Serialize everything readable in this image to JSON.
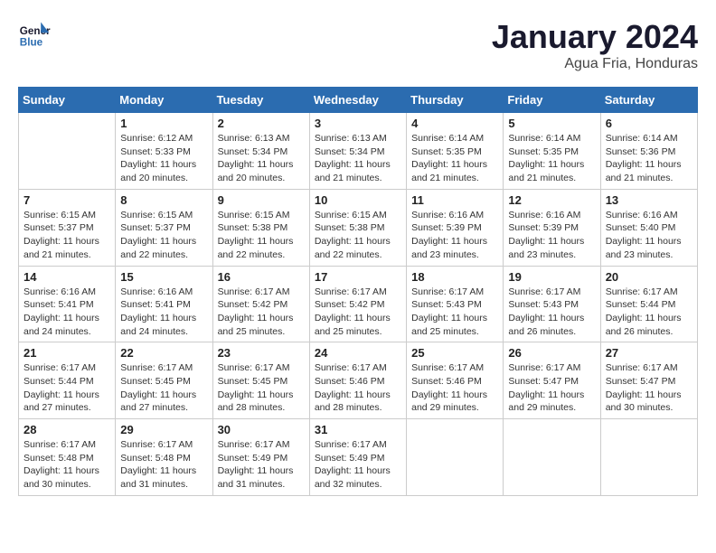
{
  "header": {
    "logo_line1": "General",
    "logo_line2": "Blue",
    "month": "January 2024",
    "location": "Agua Fria, Honduras"
  },
  "weekdays": [
    "Sunday",
    "Monday",
    "Tuesday",
    "Wednesday",
    "Thursday",
    "Friday",
    "Saturday"
  ],
  "weeks": [
    [
      {
        "day": "",
        "sunrise": "",
        "sunset": "",
        "daylight": ""
      },
      {
        "day": "1",
        "sunrise": "6:12 AM",
        "sunset": "5:33 PM",
        "daylight": "11 hours and 20 minutes."
      },
      {
        "day": "2",
        "sunrise": "6:13 AM",
        "sunset": "5:34 PM",
        "daylight": "11 hours and 20 minutes."
      },
      {
        "day": "3",
        "sunrise": "6:13 AM",
        "sunset": "5:34 PM",
        "daylight": "11 hours and 21 minutes."
      },
      {
        "day": "4",
        "sunrise": "6:14 AM",
        "sunset": "5:35 PM",
        "daylight": "11 hours and 21 minutes."
      },
      {
        "day": "5",
        "sunrise": "6:14 AM",
        "sunset": "5:35 PM",
        "daylight": "11 hours and 21 minutes."
      },
      {
        "day": "6",
        "sunrise": "6:14 AM",
        "sunset": "5:36 PM",
        "daylight": "11 hours and 21 minutes."
      }
    ],
    [
      {
        "day": "7",
        "sunrise": "6:15 AM",
        "sunset": "5:37 PM",
        "daylight": "11 hours and 21 minutes."
      },
      {
        "day": "8",
        "sunrise": "6:15 AM",
        "sunset": "5:37 PM",
        "daylight": "11 hours and 22 minutes."
      },
      {
        "day": "9",
        "sunrise": "6:15 AM",
        "sunset": "5:38 PM",
        "daylight": "11 hours and 22 minutes."
      },
      {
        "day": "10",
        "sunrise": "6:15 AM",
        "sunset": "5:38 PM",
        "daylight": "11 hours and 22 minutes."
      },
      {
        "day": "11",
        "sunrise": "6:16 AM",
        "sunset": "5:39 PM",
        "daylight": "11 hours and 23 minutes."
      },
      {
        "day": "12",
        "sunrise": "6:16 AM",
        "sunset": "5:39 PM",
        "daylight": "11 hours and 23 minutes."
      },
      {
        "day": "13",
        "sunrise": "6:16 AM",
        "sunset": "5:40 PM",
        "daylight": "11 hours and 23 minutes."
      }
    ],
    [
      {
        "day": "14",
        "sunrise": "6:16 AM",
        "sunset": "5:41 PM",
        "daylight": "11 hours and 24 minutes."
      },
      {
        "day": "15",
        "sunrise": "6:16 AM",
        "sunset": "5:41 PM",
        "daylight": "11 hours and 24 minutes."
      },
      {
        "day": "16",
        "sunrise": "6:17 AM",
        "sunset": "5:42 PM",
        "daylight": "11 hours and 25 minutes."
      },
      {
        "day": "17",
        "sunrise": "6:17 AM",
        "sunset": "5:42 PM",
        "daylight": "11 hours and 25 minutes."
      },
      {
        "day": "18",
        "sunrise": "6:17 AM",
        "sunset": "5:43 PM",
        "daylight": "11 hours and 25 minutes."
      },
      {
        "day": "19",
        "sunrise": "6:17 AM",
        "sunset": "5:43 PM",
        "daylight": "11 hours and 26 minutes."
      },
      {
        "day": "20",
        "sunrise": "6:17 AM",
        "sunset": "5:44 PM",
        "daylight": "11 hours and 26 minutes."
      }
    ],
    [
      {
        "day": "21",
        "sunrise": "6:17 AM",
        "sunset": "5:44 PM",
        "daylight": "11 hours and 27 minutes."
      },
      {
        "day": "22",
        "sunrise": "6:17 AM",
        "sunset": "5:45 PM",
        "daylight": "11 hours and 27 minutes."
      },
      {
        "day": "23",
        "sunrise": "6:17 AM",
        "sunset": "5:45 PM",
        "daylight": "11 hours and 28 minutes."
      },
      {
        "day": "24",
        "sunrise": "6:17 AM",
        "sunset": "5:46 PM",
        "daylight": "11 hours and 28 minutes."
      },
      {
        "day": "25",
        "sunrise": "6:17 AM",
        "sunset": "5:46 PM",
        "daylight": "11 hours and 29 minutes."
      },
      {
        "day": "26",
        "sunrise": "6:17 AM",
        "sunset": "5:47 PM",
        "daylight": "11 hours and 29 minutes."
      },
      {
        "day": "27",
        "sunrise": "6:17 AM",
        "sunset": "5:47 PM",
        "daylight": "11 hours and 30 minutes."
      }
    ],
    [
      {
        "day": "28",
        "sunrise": "6:17 AM",
        "sunset": "5:48 PM",
        "daylight": "11 hours and 30 minutes."
      },
      {
        "day": "29",
        "sunrise": "6:17 AM",
        "sunset": "5:48 PM",
        "daylight": "11 hours and 31 minutes."
      },
      {
        "day": "30",
        "sunrise": "6:17 AM",
        "sunset": "5:49 PM",
        "daylight": "11 hours and 31 minutes."
      },
      {
        "day": "31",
        "sunrise": "6:17 AM",
        "sunset": "5:49 PM",
        "daylight": "11 hours and 32 minutes."
      },
      {
        "day": "",
        "sunrise": "",
        "sunset": "",
        "daylight": ""
      },
      {
        "day": "",
        "sunrise": "",
        "sunset": "",
        "daylight": ""
      },
      {
        "day": "",
        "sunrise": "",
        "sunset": "",
        "daylight": ""
      }
    ]
  ]
}
